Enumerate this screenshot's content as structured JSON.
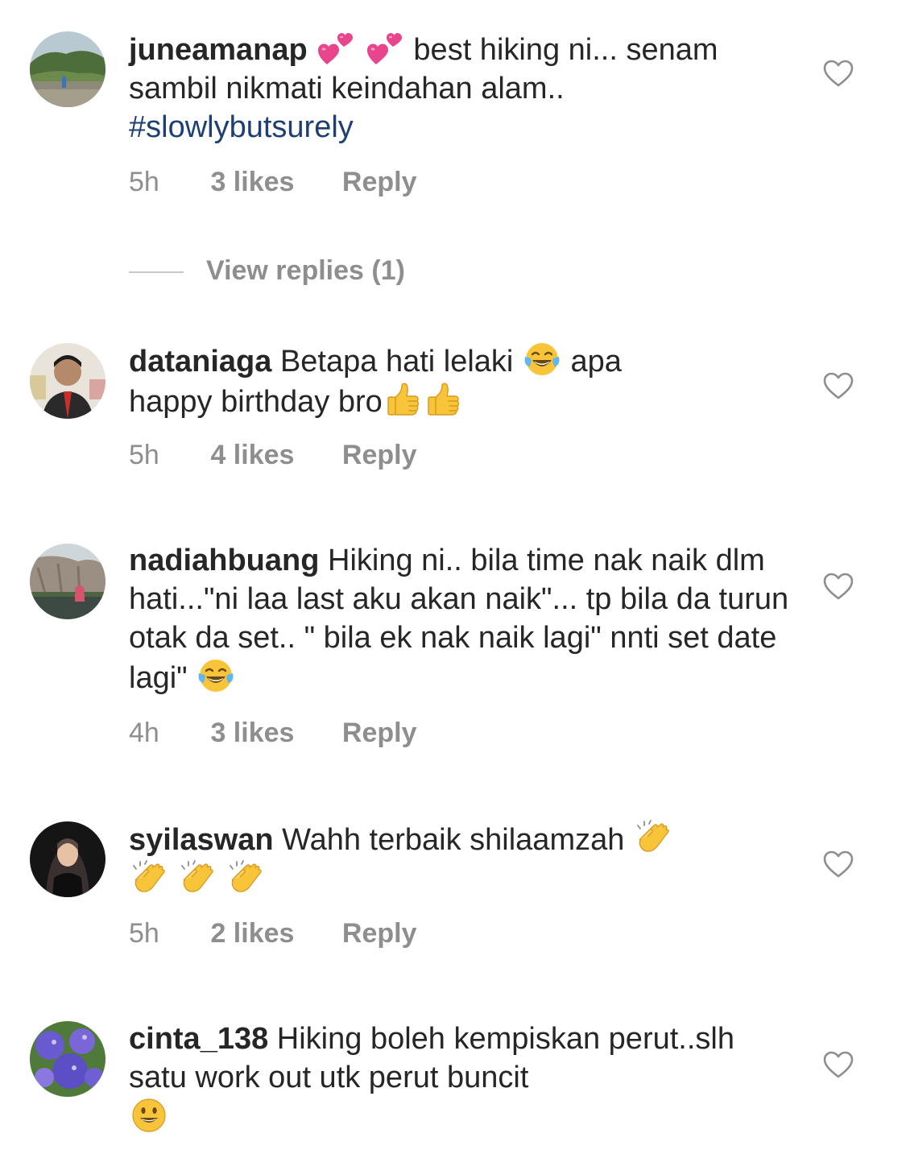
{
  "comments": [
    {
      "username": "juneamanap",
      "text_a": "best hiking ni...",
      "text_b": "senam sambil nikmati keindahan alam..",
      "hashtag": "#slowlybutsurely",
      "time": "5h",
      "likes": "3 likes",
      "reply": "Reply",
      "emojis": [
        "two-hearts",
        "two-hearts"
      ]
    },
    {
      "username": "dataniaga",
      "text_a": "Betapa hati lelaki",
      "text_b": "apa",
      "text_c": "happy birthday bro",
      "time": "5h",
      "likes": "4 likes",
      "reply": "Reply",
      "emojis": [
        "tears-of-joy",
        "thumbs-up",
        "thumbs-up"
      ]
    },
    {
      "username": "nadiahbuang",
      "text_a": "Hiking ni.. bila time nak naik dlm hati...\"ni laa last aku akan naik\"... tp bila da turun otak da set.. \" bila ek nak naik lagi\" nnti set date lagi\"",
      "time": "4h",
      "likes": "3 likes",
      "reply": "Reply",
      "emojis": [
        "tears-of-joy"
      ]
    },
    {
      "username": "syilaswan",
      "text_a": "Wahh terbaik shilaamzah",
      "time": "5h",
      "likes": "2 likes",
      "reply": "Reply",
      "emojis": [
        "clapping-hands",
        "clapping-hands",
        "clapping-hands",
        "clapping-hands"
      ]
    },
    {
      "username": "cinta_138",
      "text_a": "Hiking boleh kempiskan perut..slh satu work out utk perut buncit",
      "emojis": [
        "smiling-face"
      ]
    }
  ],
  "view_replies": "View replies (1)",
  "colors": {
    "text": "#262626",
    "meta": "#8e8e8e",
    "hashtag": "#1d3f74",
    "divider": "#c7c7c7"
  },
  "icons": {
    "like": "heart-outline-icon"
  }
}
